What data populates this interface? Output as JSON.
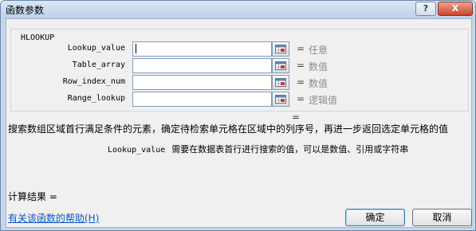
{
  "window": {
    "title": "函数参数",
    "help_button": "?",
    "close_button": "X"
  },
  "group": {
    "label": "HLOOKUP"
  },
  "arguments": [
    {
      "label": "Lookup_value",
      "value": "",
      "equals": "=",
      "hint": "任意"
    },
    {
      "label": "Table_array",
      "value": "",
      "equals": "=",
      "hint": "数值"
    },
    {
      "label": "Row_index_num",
      "value": "",
      "equals": "=",
      "hint": "数值"
    },
    {
      "label": "Range_lookup",
      "value": "",
      "equals": "=",
      "hint": "逻辑值"
    }
  ],
  "formula_equals": "=",
  "description": "搜索数组区域首行满足条件的元素，确定待检索单元格在区域中的列序号，再进一步返回选定单元格的值",
  "argument_help": {
    "name": "Lookup_value",
    "text": "需要在数据表首行进行搜索的值，可以是数值、引用或字符串"
  },
  "result_label": "计算结果 =",
  "help_link": "有关该函数的帮助(H)",
  "buttons": {
    "ok": "确定",
    "cancel": "取消"
  }
}
